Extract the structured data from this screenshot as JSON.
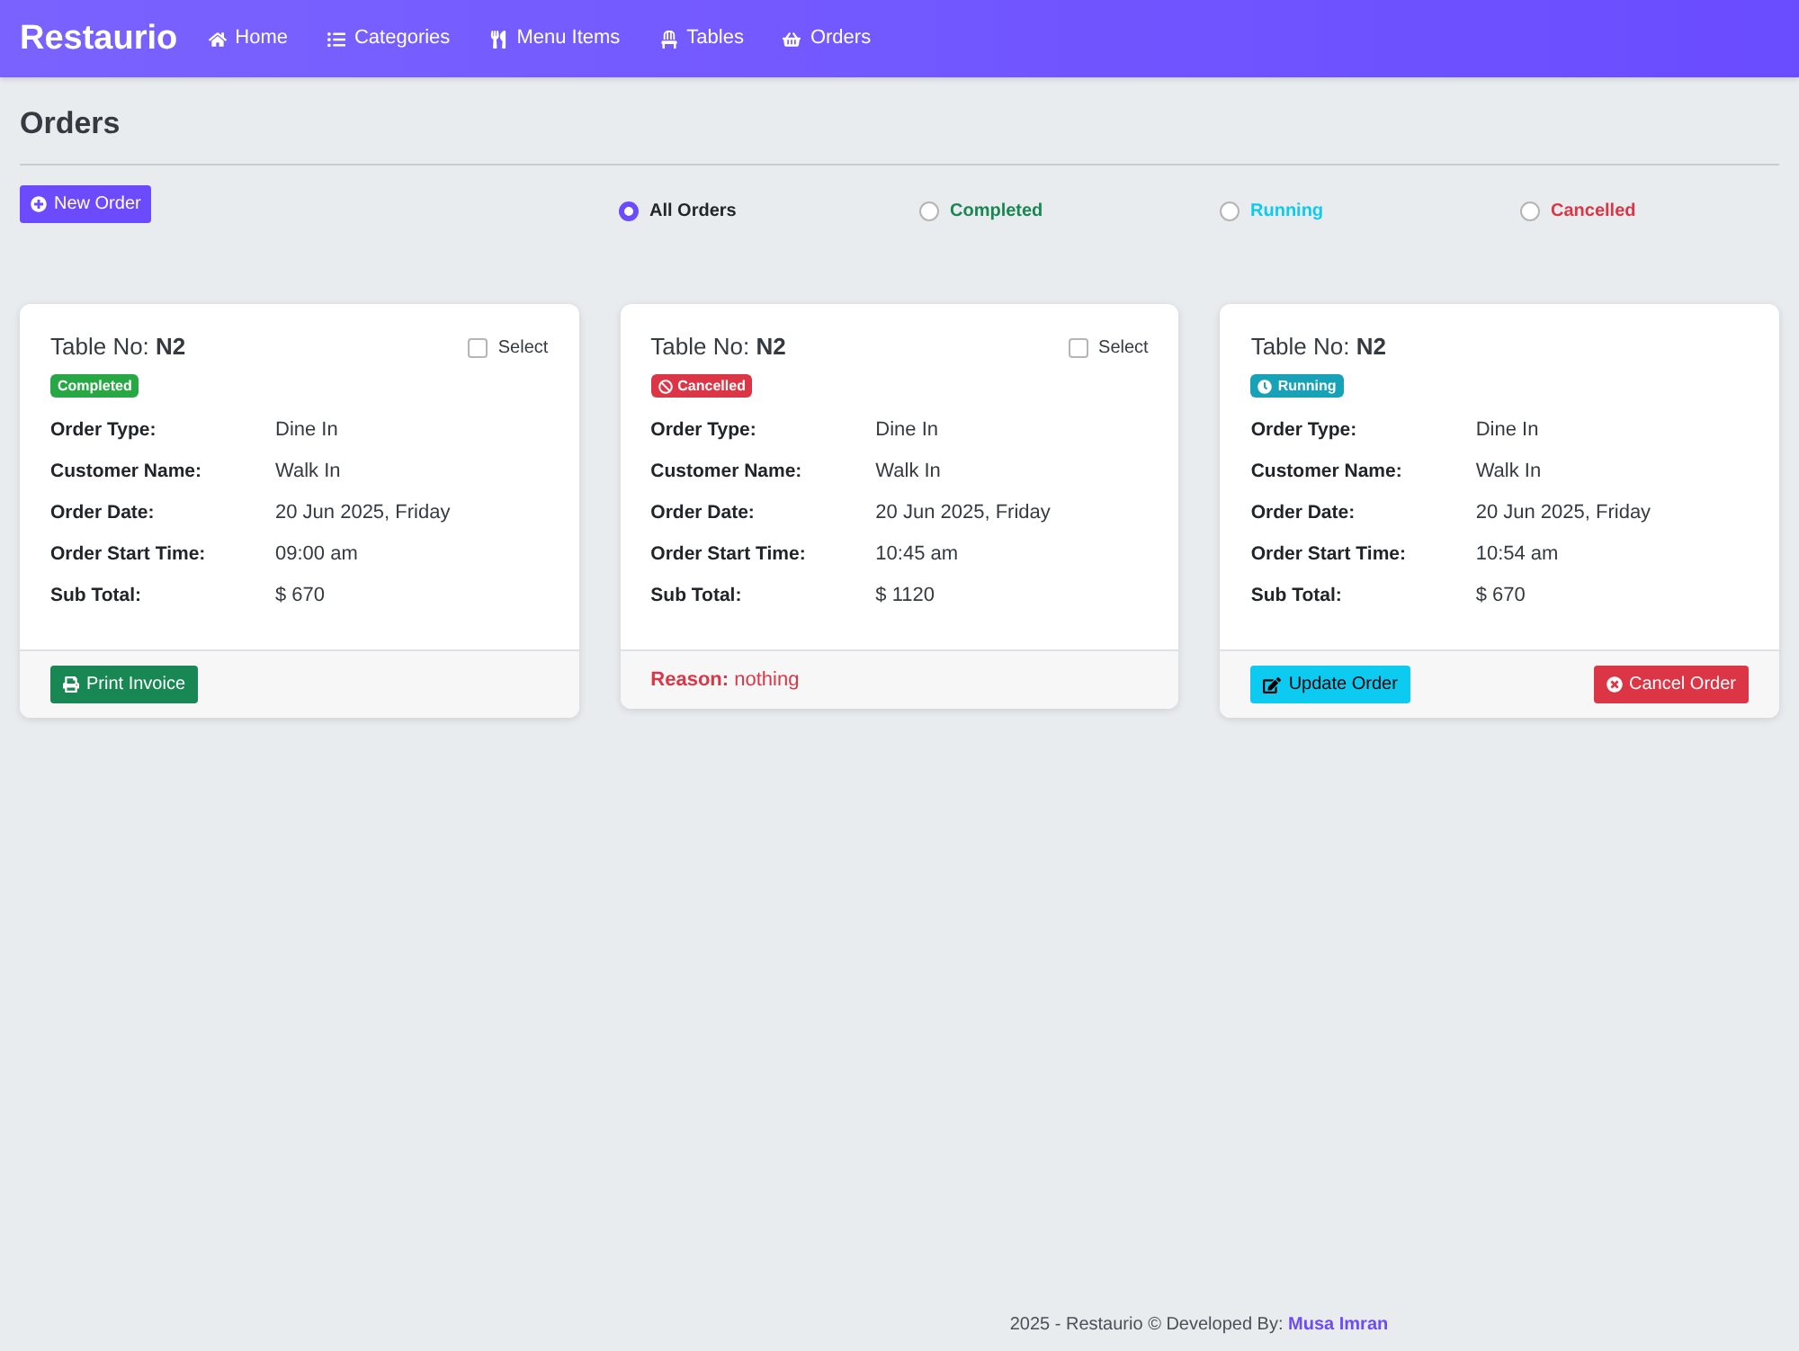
{
  "navbar": {
    "brand": "Restaurio",
    "items": [
      {
        "label": "Home"
      },
      {
        "label": "Categories"
      },
      {
        "label": "Menu Items"
      },
      {
        "label": "Tables"
      },
      {
        "label": "Orders"
      }
    ]
  },
  "page": {
    "title": "Orders"
  },
  "toolbar": {
    "new_order_button": "New Order",
    "filters": [
      {
        "label": "All Orders",
        "selected": true,
        "color": "#212529"
      },
      {
        "label": "Completed",
        "selected": false,
        "color": "#198754"
      },
      {
        "label": "Running",
        "selected": false,
        "color": "#0dcaf0"
      },
      {
        "label": "Cancelled",
        "selected": false,
        "color": "#dc3545"
      }
    ]
  },
  "orders": [
    {
      "title": "Table No: **N2**",
      "select": {
        "label": "Select",
        "checked": false
      },
      "status": {
        "kind": "completed",
        "label": "Completed"
      },
      "fields": [
        {
          "label": "Order Type:",
          "value": "Dine In"
        },
        {
          "label": "Customer Name:",
          "value": "Walk In"
        },
        {
          "label": "Order Date:",
          "value": "20 Jun 2025, Friday"
        },
        {
          "label": "Order Start Time:",
          "value": "09:00 am"
        },
        {
          "label": "Sub Total:",
          "value": "$ 670"
        }
      ],
      "footer": {
        "kind": "actions",
        "buttons": [
          {
            "kind": "print",
            "label": "Print Invoice"
          }
        ]
      }
    },
    {
      "title": "Table No: **N2**",
      "select": {
        "label": "Select",
        "checked": false
      },
      "status": {
        "kind": "cancelled",
        "label": "Cancelled"
      },
      "fields": [
        {
          "label": "Order Type:",
          "value": "Dine In"
        },
        {
          "label": "Customer Name:",
          "value": "Walk In"
        },
        {
          "label": "Order Date:",
          "value": "20 Jun 2025, Friday"
        },
        {
          "label": "Order Start Time:",
          "value": "10:45 am"
        },
        {
          "label": "Sub Total:",
          "value": "$ 1120"
        }
      ],
      "footer": {
        "kind": "reason",
        "text": "**Reason:** nothing"
      }
    },
    {
      "title": "Table No: **N2**",
      "status": {
        "kind": "running",
        "label": "Running"
      },
      "fields": [
        {
          "label": "Order Type:",
          "value": "Dine In"
        },
        {
          "label": "Customer Name:",
          "value": "Walk In"
        },
        {
          "label": "Order Date:",
          "value": "20 Jun 2025, Friday"
        },
        {
          "label": "Order Start Time:",
          "value": "10:54 am"
        },
        {
          "label": "Sub Total:",
          "value": "$ 670"
        }
      ],
      "footer": {
        "kind": "actions",
        "buttons": [
          {
            "kind": "update",
            "label": "Update Order"
          },
          {
            "kind": "cancel",
            "label": "Cancel Order"
          }
        ]
      }
    }
  ],
  "footer": {
    "text": "2025 - Restaurio © Developed By:",
    "link": "Musa Imran"
  }
}
